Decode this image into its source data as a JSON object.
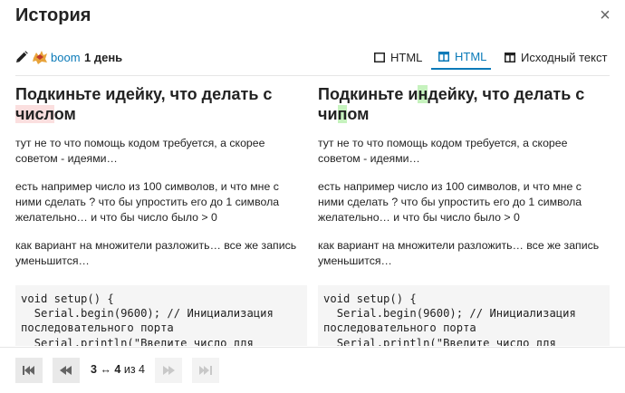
{
  "modal": {
    "title": "История",
    "close_label": "×"
  },
  "meta": {
    "username": "boom",
    "age": "1 день"
  },
  "tabs": [
    {
      "label": "HTML",
      "active": false
    },
    {
      "label": "HTML",
      "active": true
    },
    {
      "label": "Исходный текст",
      "active": false
    }
  ],
  "left": {
    "title_a": "Подкиньте идейку, что делать с ",
    "title_del": "числ",
    "title_b": "ом",
    "p1": "тут не то что помощь кодом требуется, а скорее советом - идеями…",
    "p2": "есть например число из 100 символов, и что мне с ними сделать ? что бы упростить его до 1 символа желательно… и что бы число было > 0",
    "p3": "как вариант на множители разложить… все же запись уменьшится…",
    "code": "void setup() {\n  Serial.begin(9600); // Инициализация последовательного порта\n  Serial.println(\"Введите число для разложения на простые множители:\");"
  },
  "right": {
    "title_a": "Подкиньте и",
    "title_ins1": "н",
    "title_b": "дейку, что делать с ",
    "title_c": "чи",
    "title_ins2": "п",
    "title_d": "ом",
    "p1": "тут не то что помощь кодом требуется, а скорее советом - идеями…",
    "p2": "есть например число из 100 символов, и что мне с ними сделать ? что бы упростить его до 1 символа желательно… и что бы число было > 0",
    "p3": "как вариант на множители разложить… все же запись уменьшится…",
    "code": "void setup() {\n  Serial.begin(9600); // Инициализация последовательного порта\n  Serial.println(\"Введите число для разложения на простые множители:\");"
  },
  "footer": {
    "rev_from": "3",
    "arrow": "↔",
    "rev_to": "4",
    "rev_of": "из 4"
  },
  "colors": {
    "accent": "#0a7ab8",
    "deleted": "#fbdfdf",
    "inserted": "#c6f2be"
  }
}
